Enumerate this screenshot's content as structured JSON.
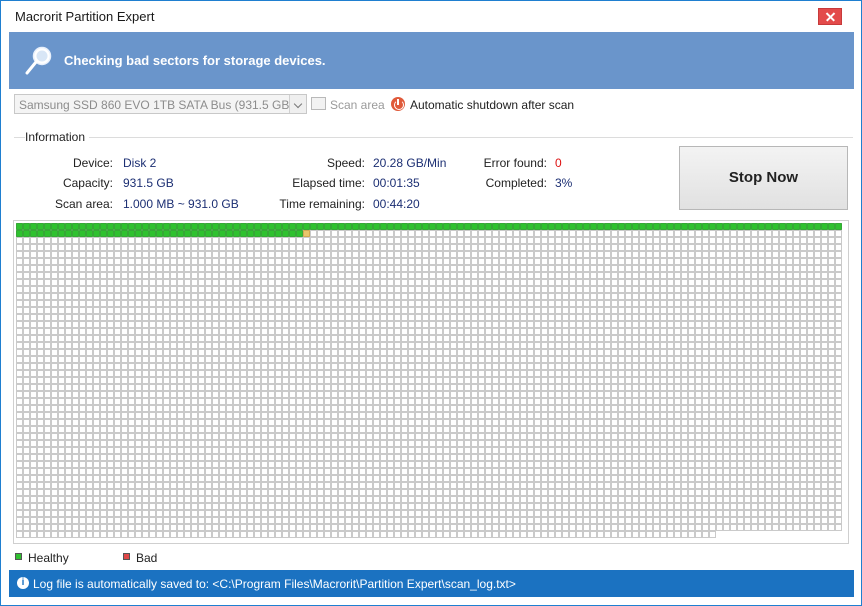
{
  "window": {
    "title": "Macrorit Partition Expert"
  },
  "banner": {
    "text": "Checking bad sectors for storage devices."
  },
  "toolbar": {
    "device_select_value": "Samsung SSD 860 EVO 1TB SATA Bus (931.5 GB)",
    "scan_area_label": "Scan area",
    "shutdown_label": "Automatic shutdown after scan"
  },
  "info": {
    "legend": "Information",
    "device_label": "Device:",
    "device_value": "Disk 2",
    "capacity_label": "Capacity:",
    "capacity_value": "931.5 GB",
    "scan_area_label": "Scan area:",
    "scan_area_value": "1.000 MB ~ 931.0 GB",
    "speed_label": "Speed:",
    "speed_value": "20.28 GB/Min",
    "elapsed_label": "Elapsed time:",
    "elapsed_value": "00:01:35",
    "remaining_label": "Time remaining:",
    "remaining_value": "00:44:20",
    "error_label": "Error found:",
    "error_value": "0",
    "completed_label": "Completed:",
    "completed_value": "3%"
  },
  "actions": {
    "stop_label": "Stop Now"
  },
  "sector_map": {
    "completed_fraction": 0.03,
    "healthy_color": "#2fc12f",
    "current_color": "#e8c56a",
    "empty_color": "#ffffff",
    "bad_color": "#e04848"
  },
  "legend": {
    "healthy_label": "Healthy",
    "bad_label": "Bad"
  },
  "statusbar": {
    "text": "Log file is automatically saved to: <C:\\Program Files\\Macrorit\\Partition Expert\\scan_log.txt>"
  },
  "icons": {
    "banner": "magnifier-icon",
    "scan_area": "scan-area-icon",
    "shutdown": "power-icon",
    "status": "info-icon",
    "close": "close-icon"
  }
}
